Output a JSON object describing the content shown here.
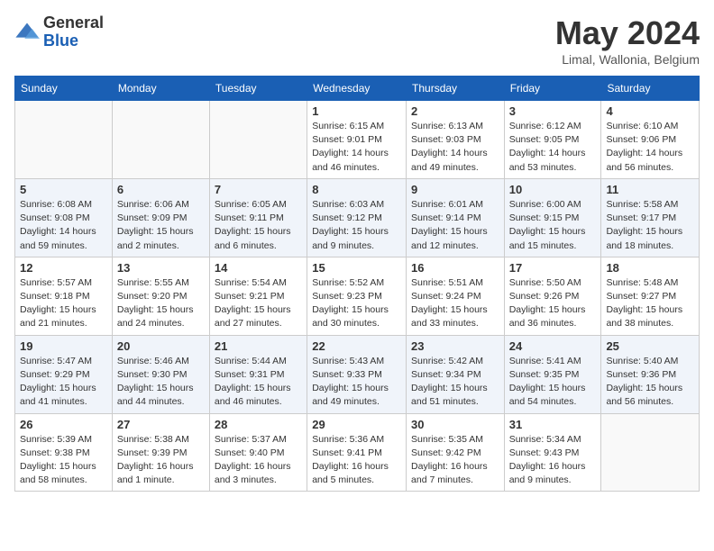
{
  "logo": {
    "general": "General",
    "blue": "Blue"
  },
  "title": "May 2024",
  "location": "Limal, Wallonia, Belgium",
  "weekdays": [
    "Sunday",
    "Monday",
    "Tuesday",
    "Wednesday",
    "Thursday",
    "Friday",
    "Saturday"
  ],
  "weeks": [
    [
      {
        "day": "",
        "sunrise": "",
        "sunset": "",
        "daylight": ""
      },
      {
        "day": "",
        "sunrise": "",
        "sunset": "",
        "daylight": ""
      },
      {
        "day": "",
        "sunrise": "",
        "sunset": "",
        "daylight": ""
      },
      {
        "day": "1",
        "sunrise": "Sunrise: 6:15 AM",
        "sunset": "Sunset: 9:01 PM",
        "daylight": "Daylight: 14 hours and 46 minutes."
      },
      {
        "day": "2",
        "sunrise": "Sunrise: 6:13 AM",
        "sunset": "Sunset: 9:03 PM",
        "daylight": "Daylight: 14 hours and 49 minutes."
      },
      {
        "day": "3",
        "sunrise": "Sunrise: 6:12 AM",
        "sunset": "Sunset: 9:05 PM",
        "daylight": "Daylight: 14 hours and 53 minutes."
      },
      {
        "day": "4",
        "sunrise": "Sunrise: 6:10 AM",
        "sunset": "Sunset: 9:06 PM",
        "daylight": "Daylight: 14 hours and 56 minutes."
      }
    ],
    [
      {
        "day": "5",
        "sunrise": "Sunrise: 6:08 AM",
        "sunset": "Sunset: 9:08 PM",
        "daylight": "Daylight: 14 hours and 59 minutes."
      },
      {
        "day": "6",
        "sunrise": "Sunrise: 6:06 AM",
        "sunset": "Sunset: 9:09 PM",
        "daylight": "Daylight: 15 hours and 2 minutes."
      },
      {
        "day": "7",
        "sunrise": "Sunrise: 6:05 AM",
        "sunset": "Sunset: 9:11 PM",
        "daylight": "Daylight: 15 hours and 6 minutes."
      },
      {
        "day": "8",
        "sunrise": "Sunrise: 6:03 AM",
        "sunset": "Sunset: 9:12 PM",
        "daylight": "Daylight: 15 hours and 9 minutes."
      },
      {
        "day": "9",
        "sunrise": "Sunrise: 6:01 AM",
        "sunset": "Sunset: 9:14 PM",
        "daylight": "Daylight: 15 hours and 12 minutes."
      },
      {
        "day": "10",
        "sunrise": "Sunrise: 6:00 AM",
        "sunset": "Sunset: 9:15 PM",
        "daylight": "Daylight: 15 hours and 15 minutes."
      },
      {
        "day": "11",
        "sunrise": "Sunrise: 5:58 AM",
        "sunset": "Sunset: 9:17 PM",
        "daylight": "Daylight: 15 hours and 18 minutes."
      }
    ],
    [
      {
        "day": "12",
        "sunrise": "Sunrise: 5:57 AM",
        "sunset": "Sunset: 9:18 PM",
        "daylight": "Daylight: 15 hours and 21 minutes."
      },
      {
        "day": "13",
        "sunrise": "Sunrise: 5:55 AM",
        "sunset": "Sunset: 9:20 PM",
        "daylight": "Daylight: 15 hours and 24 minutes."
      },
      {
        "day": "14",
        "sunrise": "Sunrise: 5:54 AM",
        "sunset": "Sunset: 9:21 PM",
        "daylight": "Daylight: 15 hours and 27 minutes."
      },
      {
        "day": "15",
        "sunrise": "Sunrise: 5:52 AM",
        "sunset": "Sunset: 9:23 PM",
        "daylight": "Daylight: 15 hours and 30 minutes."
      },
      {
        "day": "16",
        "sunrise": "Sunrise: 5:51 AM",
        "sunset": "Sunset: 9:24 PM",
        "daylight": "Daylight: 15 hours and 33 minutes."
      },
      {
        "day": "17",
        "sunrise": "Sunrise: 5:50 AM",
        "sunset": "Sunset: 9:26 PM",
        "daylight": "Daylight: 15 hours and 36 minutes."
      },
      {
        "day": "18",
        "sunrise": "Sunrise: 5:48 AM",
        "sunset": "Sunset: 9:27 PM",
        "daylight": "Daylight: 15 hours and 38 minutes."
      }
    ],
    [
      {
        "day": "19",
        "sunrise": "Sunrise: 5:47 AM",
        "sunset": "Sunset: 9:29 PM",
        "daylight": "Daylight: 15 hours and 41 minutes."
      },
      {
        "day": "20",
        "sunrise": "Sunrise: 5:46 AM",
        "sunset": "Sunset: 9:30 PM",
        "daylight": "Daylight: 15 hours and 44 minutes."
      },
      {
        "day": "21",
        "sunrise": "Sunrise: 5:44 AM",
        "sunset": "Sunset: 9:31 PM",
        "daylight": "Daylight: 15 hours and 46 minutes."
      },
      {
        "day": "22",
        "sunrise": "Sunrise: 5:43 AM",
        "sunset": "Sunset: 9:33 PM",
        "daylight": "Daylight: 15 hours and 49 minutes."
      },
      {
        "day": "23",
        "sunrise": "Sunrise: 5:42 AM",
        "sunset": "Sunset: 9:34 PM",
        "daylight": "Daylight: 15 hours and 51 minutes."
      },
      {
        "day": "24",
        "sunrise": "Sunrise: 5:41 AM",
        "sunset": "Sunset: 9:35 PM",
        "daylight": "Daylight: 15 hours and 54 minutes."
      },
      {
        "day": "25",
        "sunrise": "Sunrise: 5:40 AM",
        "sunset": "Sunset: 9:36 PM",
        "daylight": "Daylight: 15 hours and 56 minutes."
      }
    ],
    [
      {
        "day": "26",
        "sunrise": "Sunrise: 5:39 AM",
        "sunset": "Sunset: 9:38 PM",
        "daylight": "Daylight: 15 hours and 58 minutes."
      },
      {
        "day": "27",
        "sunrise": "Sunrise: 5:38 AM",
        "sunset": "Sunset: 9:39 PM",
        "daylight": "Daylight: 16 hours and 1 minute."
      },
      {
        "day": "28",
        "sunrise": "Sunrise: 5:37 AM",
        "sunset": "Sunset: 9:40 PM",
        "daylight": "Daylight: 16 hours and 3 minutes."
      },
      {
        "day": "29",
        "sunrise": "Sunrise: 5:36 AM",
        "sunset": "Sunset: 9:41 PM",
        "daylight": "Daylight: 16 hours and 5 minutes."
      },
      {
        "day": "30",
        "sunrise": "Sunrise: 5:35 AM",
        "sunset": "Sunset: 9:42 PM",
        "daylight": "Daylight: 16 hours and 7 minutes."
      },
      {
        "day": "31",
        "sunrise": "Sunrise: 5:34 AM",
        "sunset": "Sunset: 9:43 PM",
        "daylight": "Daylight: 16 hours and 9 minutes."
      },
      {
        "day": "",
        "sunrise": "",
        "sunset": "",
        "daylight": ""
      }
    ]
  ]
}
